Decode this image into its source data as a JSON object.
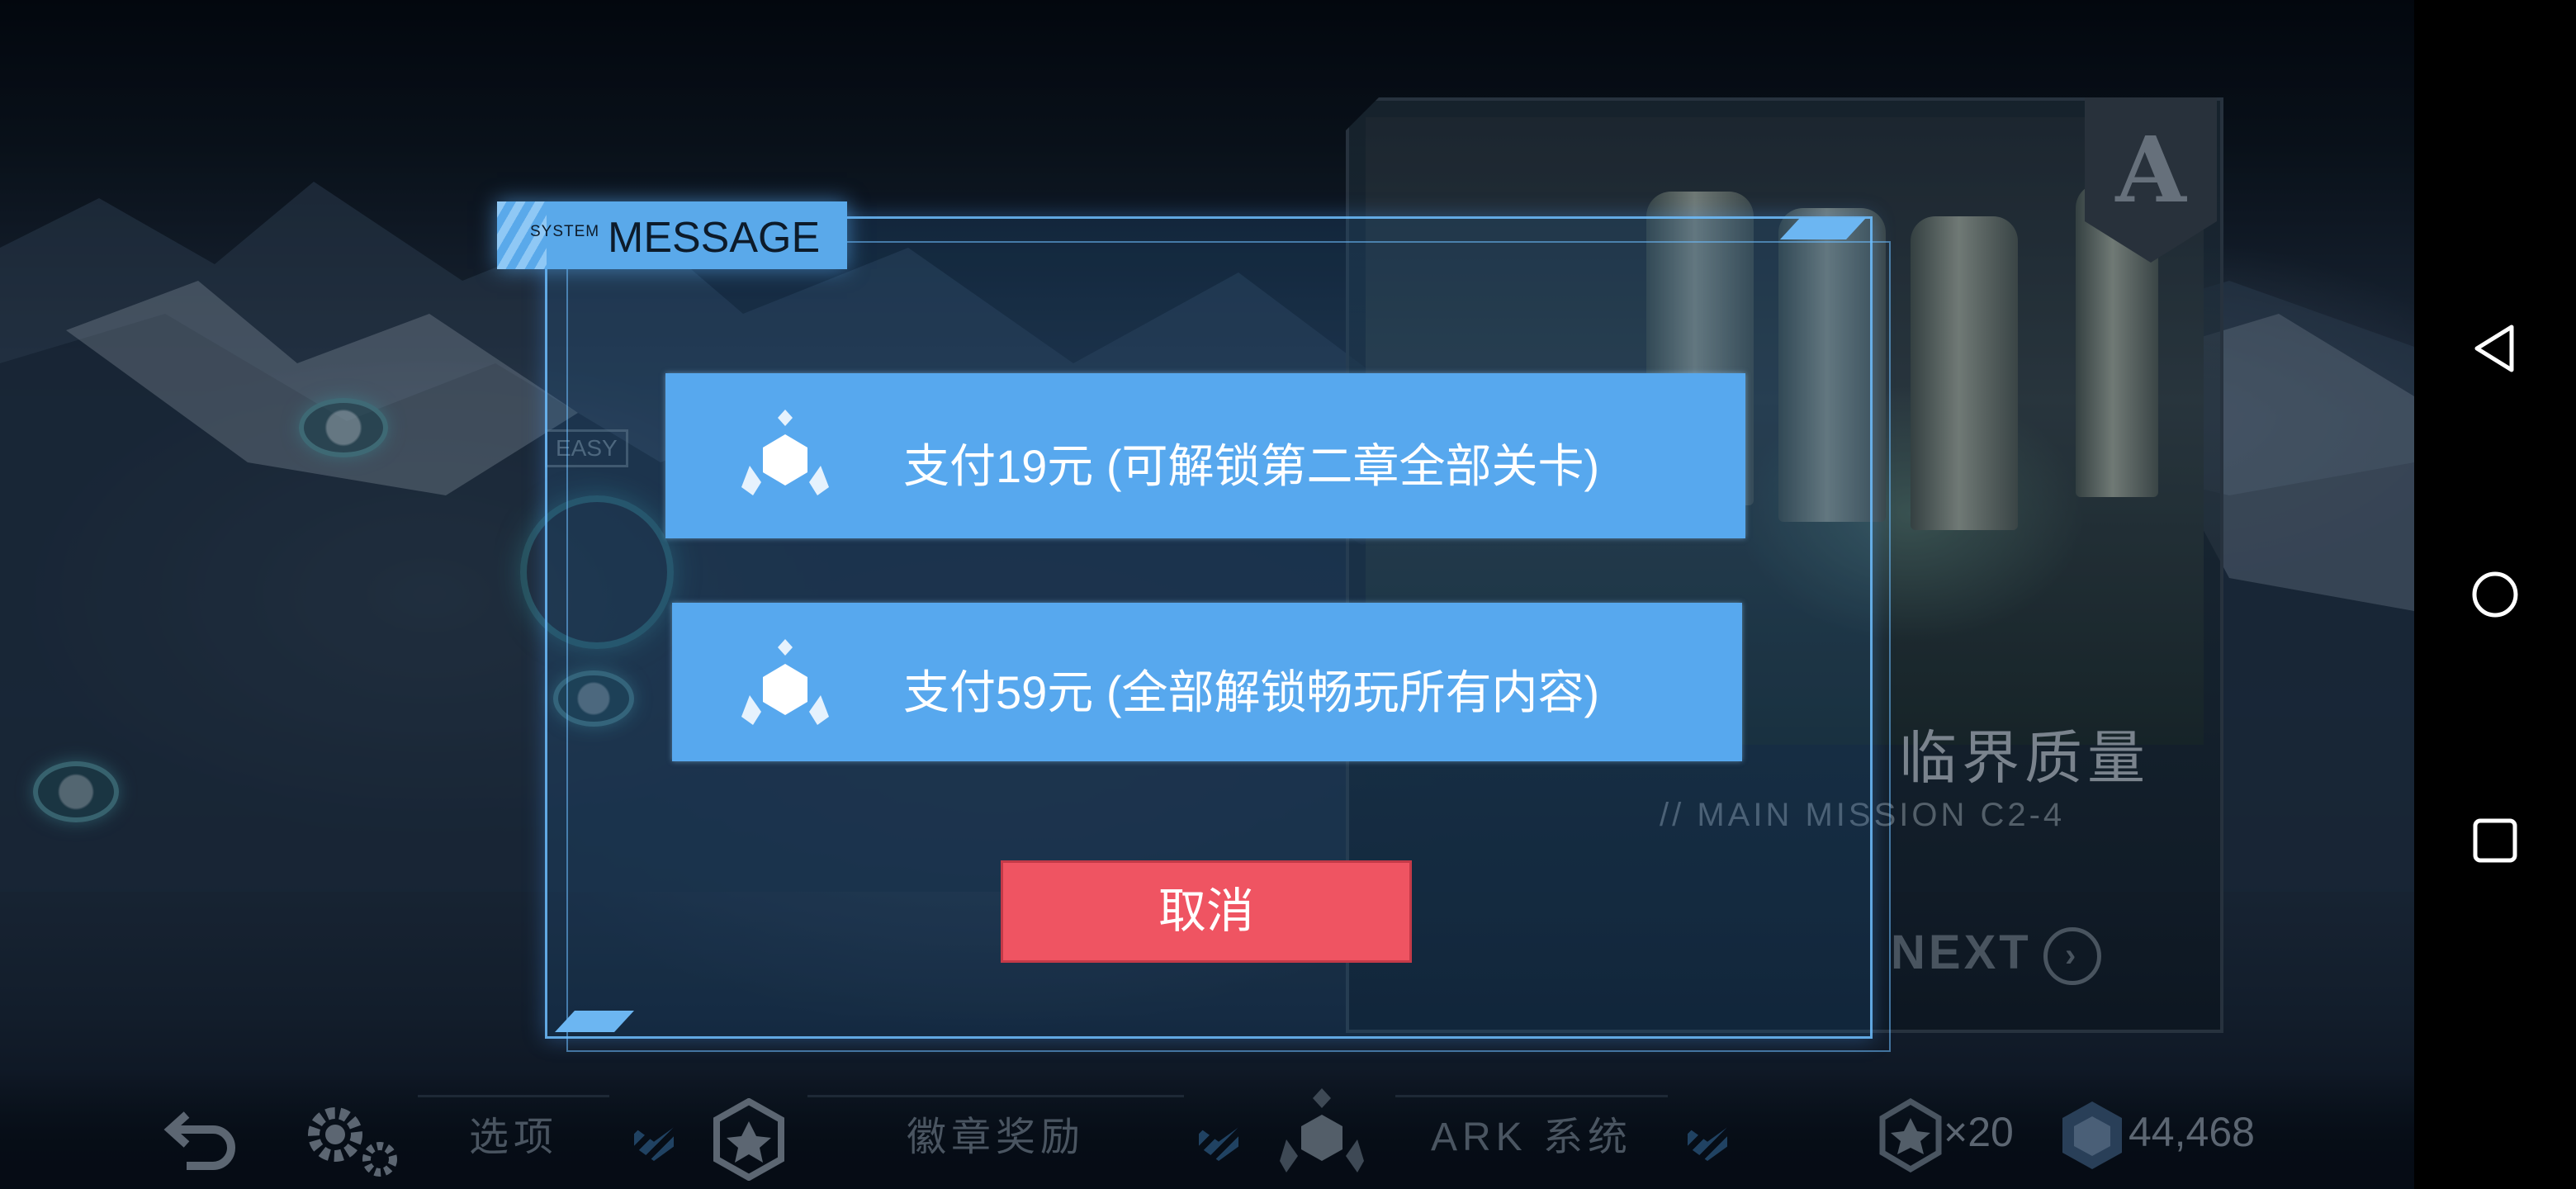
{
  "modal": {
    "tab_small": "SYSTEM",
    "tab_title": "MESSAGE",
    "options": [
      {
        "label": "支付19元 (可解锁第二章全部关卡)",
        "icon": "ark-crystal-icon"
      },
      {
        "label": "支付59元 (全部解锁畅玩所有内容)",
        "icon": "ark-crystal-icon"
      }
    ],
    "cancel_label": "取消"
  },
  "mission_card": {
    "title": "临界质量",
    "subtitle": "// MAIN MISSION C2-4",
    "next_label": "NEXT",
    "emblem_letter": "A"
  },
  "map": {
    "difficulty_tag": "EASY"
  },
  "bottom_bar": {
    "options_label": "选项",
    "badges_label": "徽章奖励",
    "ark_label": "ARK 系统",
    "badge_count": "×20",
    "currency": "44,468"
  },
  "colors": {
    "accent_blue": "#57a8ee",
    "cancel_red": "#ef5462",
    "frame_blue": "#6ebeff"
  }
}
